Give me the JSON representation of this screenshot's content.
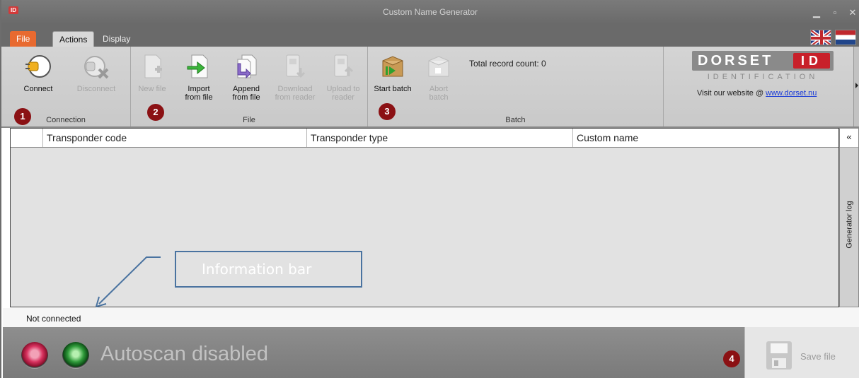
{
  "window": {
    "title": "Custom Name Generator",
    "app_icon_text": "ID"
  },
  "tabs": [
    {
      "label": "File"
    },
    {
      "label": "Actions"
    },
    {
      "label": "Display"
    }
  ],
  "ribbon": {
    "connection": {
      "label": "Connection",
      "connect": "Connect",
      "disconnect": "Disconnect"
    },
    "file": {
      "label": "File",
      "new_file": "New file",
      "import_l1": "Import",
      "import_l2": "from file",
      "append_l1": "Append",
      "append_l2": "from file",
      "download_l1": "Download",
      "download_l2": "from reader",
      "upload_l1": "Upload to",
      "upload_l2": "reader"
    },
    "batch": {
      "label": "Batch",
      "start": "Start batch",
      "abort_l1": "Abort",
      "abort_l2": "batch",
      "record_count": "Total record count:  0"
    },
    "logo": {
      "name": "DORSET",
      "id": "ID",
      "sub": "IDENTIFICATION",
      "visit_text": "Visit our website @ ",
      "visit_link": "www.dorset.nu"
    }
  },
  "badges": [
    "1",
    "2",
    "3",
    "4"
  ],
  "table": {
    "columns": [
      "Transponder code",
      "Transponder type",
      "Custom name"
    ],
    "rows": []
  },
  "side_panel": {
    "collapse": "«",
    "label": "Generator log"
  },
  "annotation": {
    "info_bar": "Information bar"
  },
  "status": {
    "text": "Not connected"
  },
  "bottom": {
    "autoscan": "Autoscan disabled",
    "save": "Save file"
  },
  "colors": {
    "accent_orange": "#e86a30",
    "badge_red": "#8b1114",
    "logo_red": "#c8202a",
    "annotation_blue": "#4a73a0"
  }
}
